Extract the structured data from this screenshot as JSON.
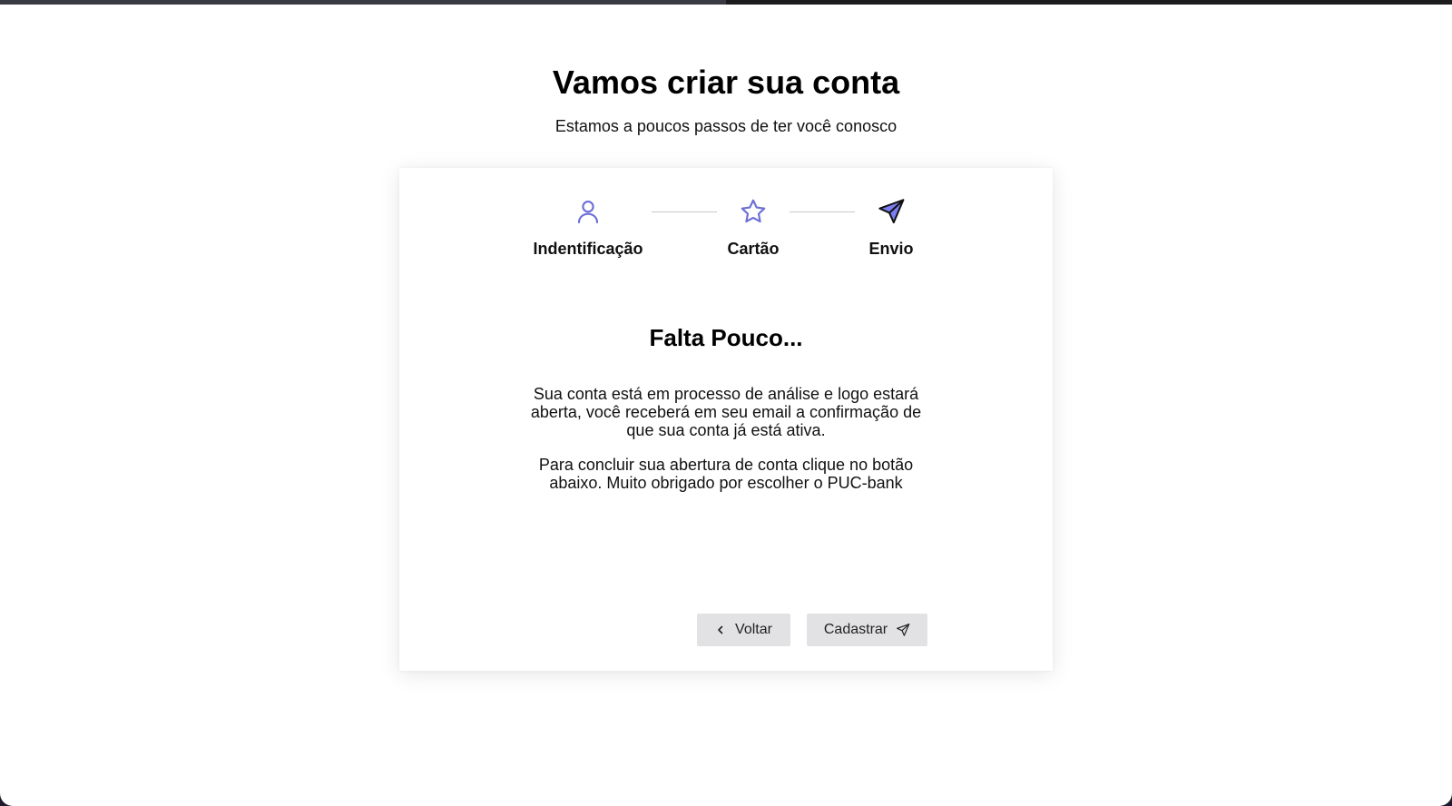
{
  "header": {
    "title": "Vamos criar sua conta",
    "subtitle": "Estamos a poucos passos de ter você conosco"
  },
  "progress": {
    "completed_fraction": 0.5
  },
  "steps": [
    {
      "label": "Indentificação",
      "icon": "user-icon",
      "color": "#6c6fd6"
    },
    {
      "label": "Cartão",
      "icon": "star-icon",
      "color": "#6c6fd6"
    },
    {
      "label": "Envio",
      "icon": "send-icon",
      "color": "#7b7ef0",
      "active": true
    }
  ],
  "content": {
    "title": "Falta Pouco...",
    "paragraph_1": "Sua conta está em processo de análise e logo estará aberta, você receberá em seu email a confirmação de que sua conta já está ativa.",
    "paragraph_2": "Para concluir sua abertura de conta clique no botão abaixo. Muito obrigado por escolher o PUC-bank"
  },
  "buttons": {
    "back_label": "Voltar",
    "back_icon": "chevron-left-icon",
    "submit_label": "Cadastrar",
    "submit_icon": "send-icon"
  },
  "colors": {
    "accent": "#6c6fd6",
    "button_bg": "#e2e2e4"
  }
}
